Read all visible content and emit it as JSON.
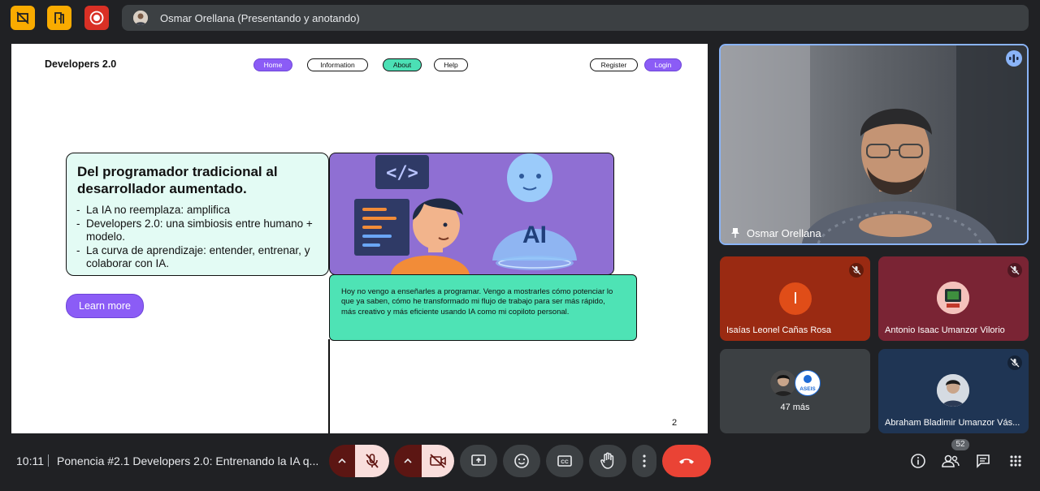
{
  "topbar": {
    "presenter_label": "Osmar Orellana (Presentando y anotando)"
  },
  "slide": {
    "brand": "Developers 2.0",
    "nav": [
      "Home",
      "Information",
      "About",
      "Help"
    ],
    "auth": [
      "Register",
      "Login"
    ],
    "card_title": "Del programador tradicional al desarrollador aumentado.",
    "bullets": [
      "La IA no reemplaza: amplifica",
      "Developers 2.0: una simbiosis entre humano + modelo.",
      "La curva de aprendizaje: entender, entrenar, y colaborar con IA."
    ],
    "learn_more": "Learn more",
    "illustration": {
      "code_tag": "</>",
      "ai_label": "AI"
    },
    "speech": "Hoy no vengo a enseñarles a programar. Vengo a mostrarles cómo potenciar lo que ya saben, cómo he transformado mi flujo de trabajo para ser más rápido, más creativo y más eficiente usando IA como mi copiloto personal.",
    "page_number": "2"
  },
  "participants": {
    "main": {
      "name": "Osmar Orellana"
    },
    "tile1": {
      "initial": "I",
      "name": "Isaías Leonel Cañas Rosa",
      "bg": "#9a2a12"
    },
    "tile2": {
      "name": "Antonio Isaac Umanzor Vilorio",
      "bg": "#7a2434"
    },
    "tile3": {
      "more": "47 más",
      "badge": "ASEIS",
      "bg": "#3c4043"
    },
    "tile4": {
      "name": "Abraham Bladimir Umanzor Vás...",
      "bg": "#1f3554"
    }
  },
  "bottombar": {
    "time": "10:11",
    "meeting_title": "Ponencia #2.1 Developers 2.0: Entrenando la IA q...",
    "people_count": "52"
  },
  "colors": {
    "accent_yellow": "#f9ab00",
    "record_red": "#d93025",
    "end_call": "#ea4335",
    "purple": "#8b5cf6",
    "teal": "#4ee3b5"
  }
}
